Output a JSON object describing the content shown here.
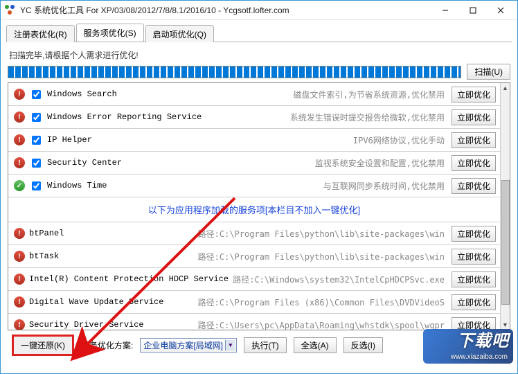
{
  "window": {
    "title": "YC 系统优化工具 For XP/03/08/2012/7/8/8.1/2016/10 - Ycgsotf.lofter.com"
  },
  "tabs": [
    {
      "label": "注册表优化(R)"
    },
    {
      "label": "服务项优化(S)",
      "active": true
    },
    {
      "label": "启动项优化(Q)"
    }
  ],
  "scan": {
    "message": "扫描完毕,请根据个人需求进行优化!",
    "button": "扫描(U)"
  },
  "opt_button": "立即优化",
  "section_title": "以下为应用程序加载的服务项[本栏目不加入一键优化]",
  "services_top": [
    {
      "name": "Windows Search",
      "note": "磁盘文件索引,为节省系统资源,优化禁用",
      "status": "red",
      "chk": true
    },
    {
      "name": "Windows Error Reporting Service",
      "note": "系统发生错误时提交报告给微软,优化禁用",
      "status": "red",
      "chk": true
    },
    {
      "name": "IP Helper",
      "note": "IPV6网络协议,优化手动",
      "status": "red",
      "chk": true
    },
    {
      "name": "Security Center",
      "note": "监视系统安全设置和配置,优化禁用",
      "status": "red",
      "chk": true
    },
    {
      "name": "Windows Time",
      "note": "与互联网同步系统时间,优化禁用",
      "status": "green",
      "chk": true
    }
  ],
  "services_bottom": [
    {
      "name": "btPanel",
      "note": "路径:C:\\Program Files\\python\\lib\\site-packages\\win",
      "status": "red"
    },
    {
      "name": "btTask",
      "note": "路径:C:\\Program Files\\python\\lib\\site-packages\\win",
      "status": "red"
    },
    {
      "name": "Intel(R) Content Protection HDCP Service",
      "note": "路径:C:\\Windows\\system32\\IntelCpHDCPSvc.exe",
      "status": "red"
    },
    {
      "name": "Digital Wave Update Service",
      "note": "路径:C:\\Program Files (x86)\\Common Files\\DVDVideoS",
      "status": "red"
    },
    {
      "name": "Security Driver Service",
      "note": "路径:C:\\Users\\pc\\AppData\\Roaming\\whstdk\\spool\\wqpr",
      "status": "red"
    }
  ],
  "bottombar": {
    "restore": "一键还原(K)",
    "plan_label": "服务优化方案:",
    "plan_value": "企业电脑方案[局域网]",
    "execute": "执行(T)",
    "selall": "全选(A)",
    "invert": "反选(I)"
  },
  "watermark": {
    "brand": "下载吧",
    "url": "www.xiazaiba.com"
  }
}
